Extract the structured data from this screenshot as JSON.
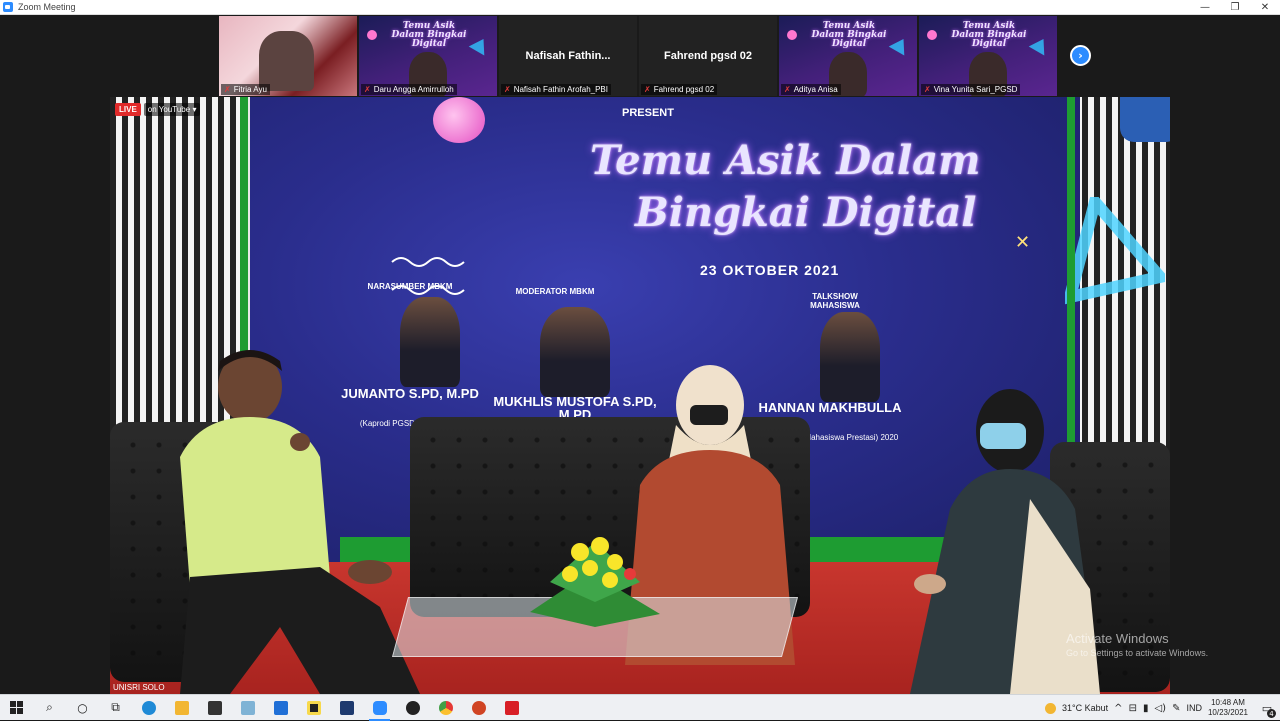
{
  "window": {
    "title": "Zoom Meeting",
    "controls": [
      "—",
      "❐",
      "✕"
    ]
  },
  "participants": [
    {
      "name": "Fitria Ayu",
      "type": "video-1"
    },
    {
      "name": "Daru Angga Amirrulloh",
      "type": "poster"
    },
    {
      "name": "Nafisah Fathin Arofah_PBI",
      "type": "blank",
      "display_name": "Nafisah  Fathin..."
    },
    {
      "name": "Fahrend pgsd  02",
      "type": "blank",
      "display_name": "Fahrend pgsd  02"
    },
    {
      "name": "Aditya Anisa",
      "type": "poster"
    },
    {
      "name": "Vina Yunita Sari_PGSD",
      "type": "poster"
    }
  ],
  "thumbnail_poster_title": "Temu Asik Dalam Bingkai Digital",
  "main_video": {
    "live_badge": "LIVE",
    "stream_target": "on YouTube",
    "source_label": "UNISRI SOLO",
    "banner": {
      "present": "PRESENT",
      "title_line1": "Temu Asik Dalam",
      "title_line2": "Bingkai Digital",
      "date": "23 OKTOBER 2021",
      "speakers": [
        {
          "role": "NARASUMBER MBKM",
          "name": "JUMANTO S.PD, M.PD",
          "sub": "(Kaprodi PGSD FKIP Unisri)"
        },
        {
          "role": "MODERATOR MBKM",
          "name": "MUKHLIS MUSTOFA S.PD, M.PD",
          "sub": ""
        },
        {
          "role": "TALKSHOW MAHASISWA",
          "name": "HANNAN MAKHBULLA",
          "sub": "(Mahasiswa Prestasi) 2020"
        }
      ]
    }
  },
  "watermark": {
    "line1": "Activate Windows",
    "line2": "Go to Settings to activate Windows."
  },
  "taskbar": {
    "weather": "31°C  Kabut",
    "lang": "IND",
    "time": "10:48 AM",
    "date": "10/23/2021",
    "notifications": "4",
    "app_colors": {
      "edge": "#1f8ad6",
      "explorer": "#f2b632",
      "store": "#333333",
      "mail": "#1f6fd6",
      "zoom": "#2d8cff",
      "powerpoint": "#d04423",
      "acrobat": "#d81f26"
    }
  }
}
